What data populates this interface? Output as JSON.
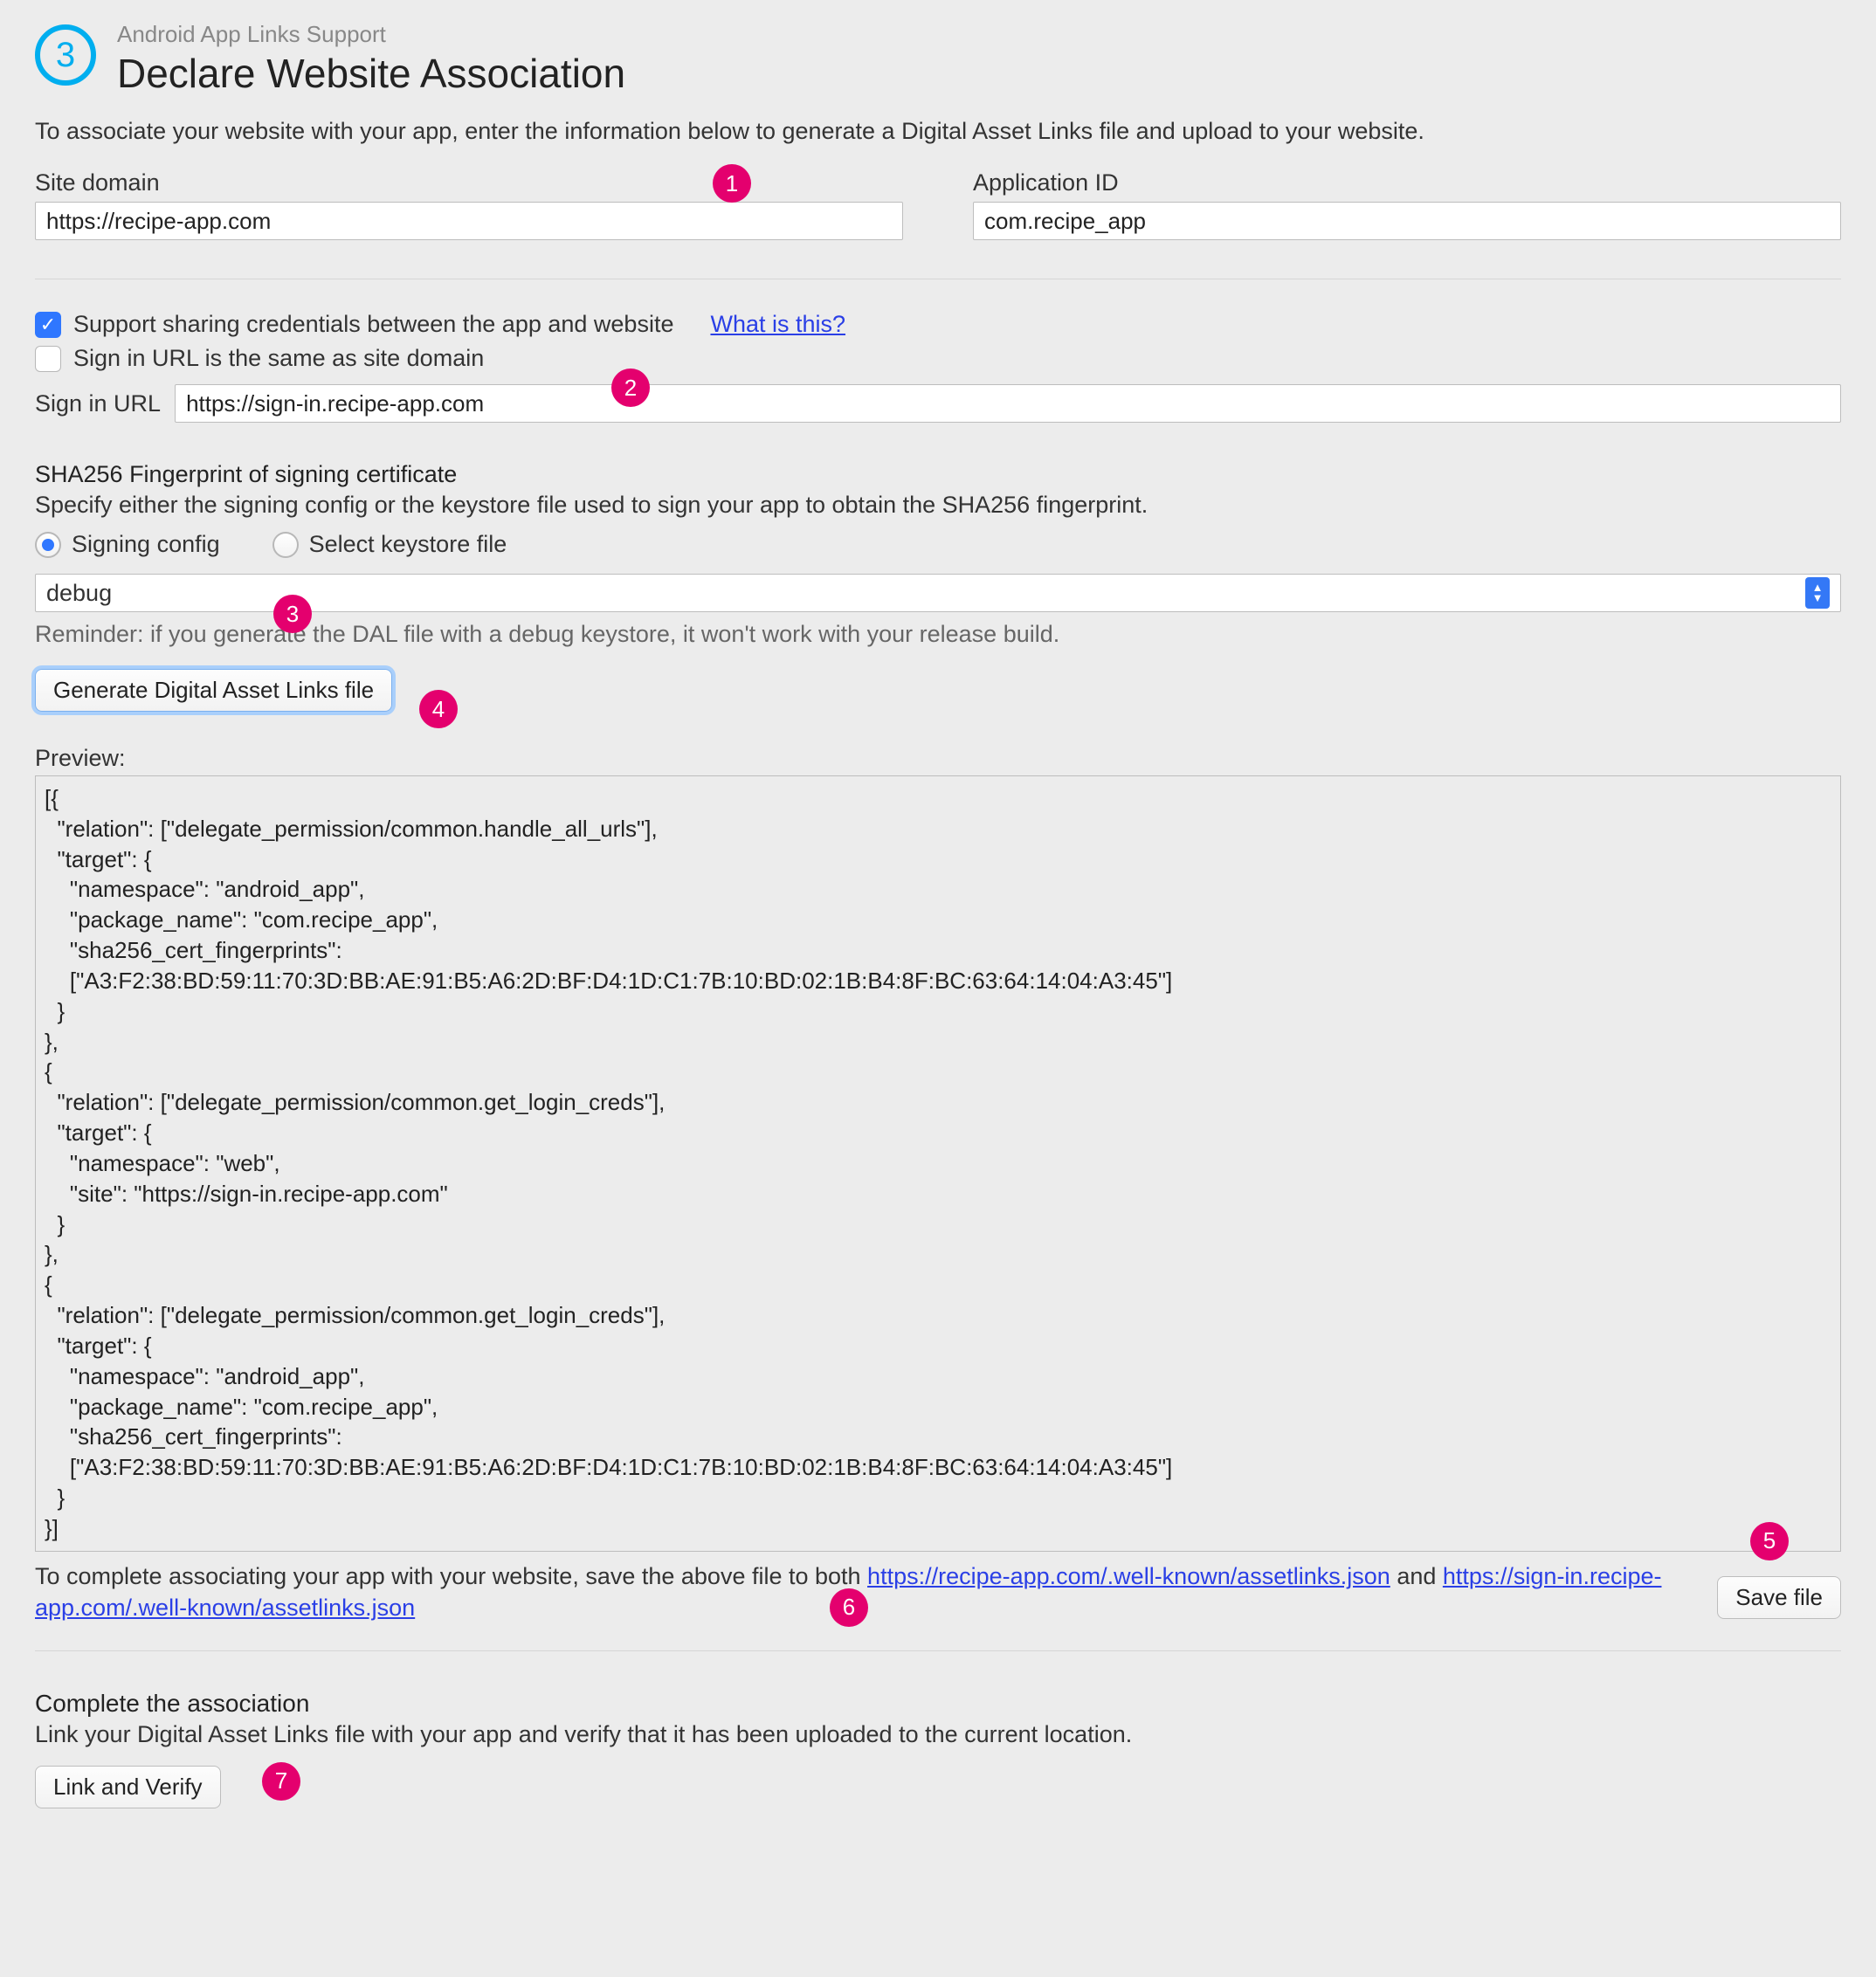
{
  "step_number": "3",
  "subtitle": "Android App Links Support",
  "title": "Declare Website Association",
  "intro": "To associate your website with your app, enter the information below to generate a Digital Asset Links file and upload to your website.",
  "site_domain": {
    "label": "Site domain",
    "value": "https://recipe-app.com"
  },
  "application_id": {
    "label": "Application ID",
    "value": "com.recipe_app"
  },
  "support_sharing": {
    "label": "Support sharing credentials between the app and website",
    "checked": true
  },
  "what_is_this": "What is this?",
  "signin_same": {
    "label": "Sign in URL is the same as site domain",
    "checked": false
  },
  "signin_url": {
    "label": "Sign in URL",
    "value": "https://sign-in.recipe-app.com"
  },
  "sha_section": {
    "title": "SHA256 Fingerprint of signing certificate",
    "desc": "Specify either the signing config or the keystore file used to sign your app to obtain the SHA256 fingerprint."
  },
  "radio": {
    "option1": "Signing config",
    "option2": "Select keystore file",
    "selected": "option1"
  },
  "signing_config_value": "debug",
  "reminder": "Reminder: if you generate the DAL file with a debug keystore, it won't work with your release build.",
  "generate_button": "Generate Digital Asset Links file",
  "preview_label": "Preview:",
  "preview_content": "[{\n  \"relation\": [\"delegate_permission/common.handle_all_urls\"],\n  \"target\": {\n    \"namespace\": \"android_app\",\n    \"package_name\": \"com.recipe_app\",\n    \"sha256_cert_fingerprints\":\n    [\"A3:F2:38:BD:59:11:70:3D:BB:AE:91:B5:A6:2D:BF:D4:1D:C1:7B:10:BD:02:1B:B4:8F:BC:63:64:14:04:A3:45\"]\n  }\n},\n{\n  \"relation\": [\"delegate_permission/common.get_login_creds\"],\n  \"target\": {\n    \"namespace\": \"web\",\n    \"site\": \"https://sign-in.recipe-app.com\"\n  }\n},\n{\n  \"relation\": [\"delegate_permission/common.get_login_creds\"],\n  \"target\": {\n    \"namespace\": \"android_app\",\n    \"package_name\": \"com.recipe_app\",\n    \"sha256_cert_fingerprints\":\n    [\"A3:F2:38:BD:59:11:70:3D:BB:AE:91:B5:A6:2D:BF:D4:1D:C1:7B:10:BD:02:1B:B4:8F:BC:63:64:14:04:A3:45\"]\n  }\n}]",
  "complete_assoc": {
    "prefix": "To complete associating your app with your website, save the above file to both ",
    "link1": "https://recipe-app.com/.well-known/assetlinks.json",
    "mid": " and ",
    "link2": "https://sign-in.recipe-app.com/.well-known/assetlinks.json"
  },
  "save_file_button": "Save file",
  "bottom": {
    "title": "Complete the association",
    "desc": "Link your Digital Asset Links file with your app and verify that it has been uploaded to the current location.",
    "button": "Link and Verify"
  },
  "callouts": {
    "c1": "1",
    "c2": "2",
    "c3": "3",
    "c4": "4",
    "c5": "5",
    "c6": "6",
    "c7": "7"
  }
}
